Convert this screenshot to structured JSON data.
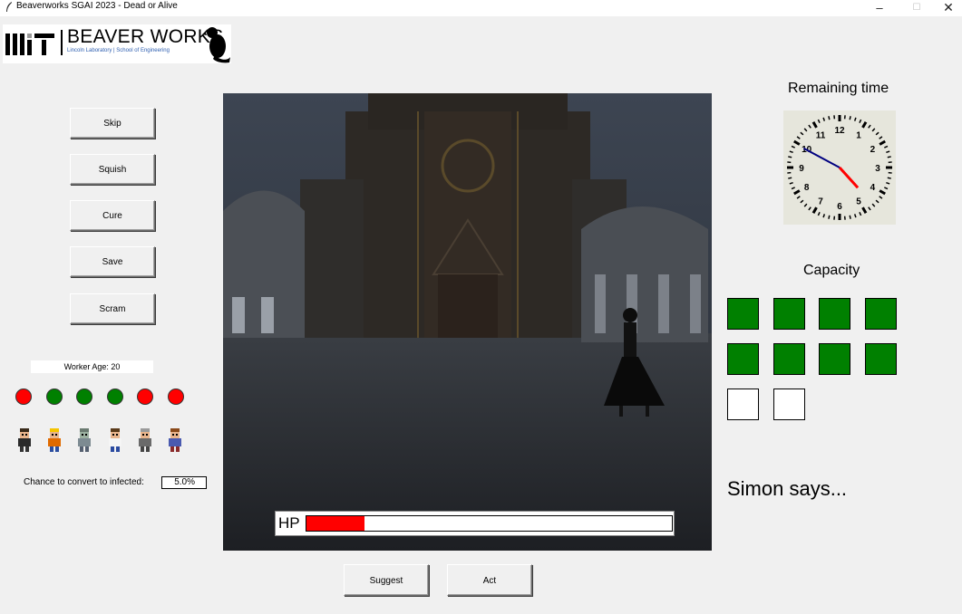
{
  "window": {
    "title": "Beaverworks SGAI 2023 - Dead or Alive",
    "minimize_glyph": "–",
    "maximize_glyph": "☐",
    "close_glyph": "✕"
  },
  "logo": {
    "brand_text": "BEAVER WORKS",
    "subtitle_text": "Lincoln Laboratory | School of Engineering"
  },
  "actions": {
    "skip": "Skip",
    "squish": "Squish",
    "cure": "Cure",
    "save": "Save",
    "scram": "Scram"
  },
  "worker": {
    "age_text": "Worker Age: 20",
    "status_dots": [
      "#ff0000",
      "#008000",
      "#008000",
      "#008000",
      "#ff0000",
      "#ff0000"
    ],
    "people_icons": [
      "man-in-suit-icon",
      "construction-worker-icon",
      "zombie-icon",
      "doctor-icon",
      "old-person-icon",
      "woman-icon"
    ]
  },
  "infection": {
    "label": "Chance to convert to infected:",
    "value": "5.0%"
  },
  "hp": {
    "label": "HP",
    "fraction": 0.16
  },
  "clock": {
    "title": "Remaining time",
    "numbers": [
      "12",
      "1",
      "2",
      "3",
      "4",
      "5",
      "6",
      "7",
      "8",
      "9",
      "10",
      "11"
    ],
    "hour": 4.6,
    "minute": 49.7
  },
  "capacity": {
    "title": "Capacity",
    "slots": [
      "filled",
      "filled",
      "filled",
      "filled",
      "filled",
      "filled",
      "filled",
      "filled",
      "empty",
      "empty"
    ],
    "filled_color": "#008000",
    "empty_color": "#ffffff"
  },
  "simon": {
    "text": "Simon says..."
  },
  "bottom_buttons": {
    "suggest": "Suggest",
    "act": "Act"
  }
}
